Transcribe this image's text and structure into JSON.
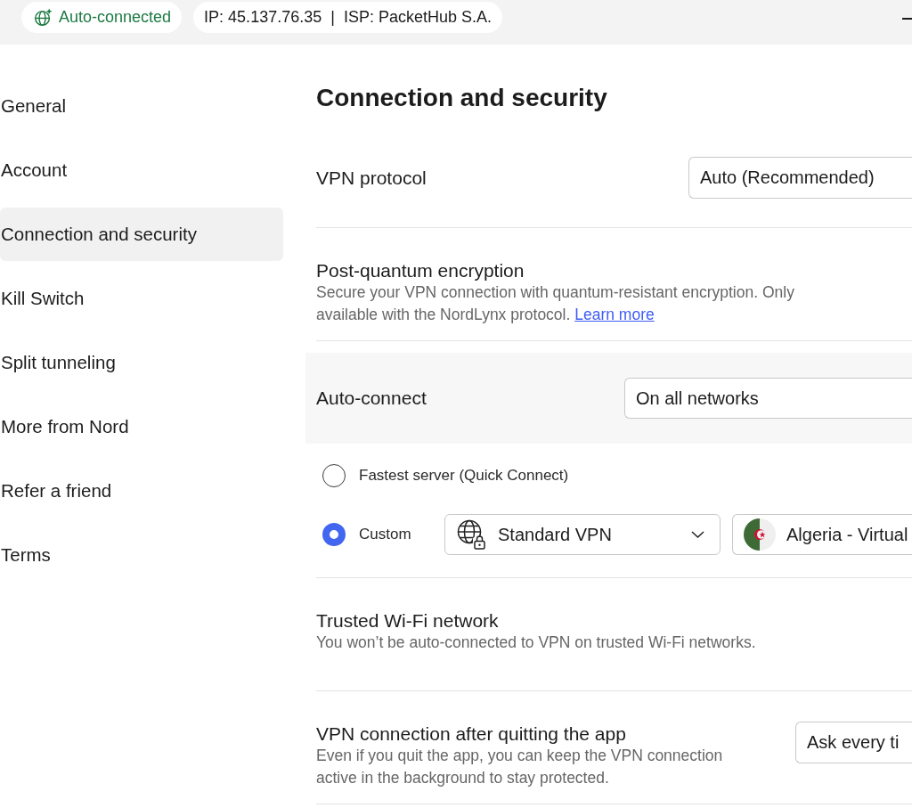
{
  "top_bar": {
    "status": "Auto-connected",
    "connection_info": "IP: 45.137.76.35  |  ISP: PacketHub S.A."
  },
  "sidebar": {
    "items": [
      {
        "label": "General",
        "selected": false
      },
      {
        "label": "Account",
        "selected": false
      },
      {
        "label": "Connection and security",
        "selected": true
      },
      {
        "label": "Kill Switch",
        "selected": false
      },
      {
        "label": "Split tunneling",
        "selected": false
      },
      {
        "label": "More from Nord",
        "selected": false
      },
      {
        "label": "Refer a friend",
        "selected": false
      },
      {
        "label": "Terms",
        "selected": false
      }
    ]
  },
  "content": {
    "title": "Connection and security",
    "settings": [
      {
        "kind": "select",
        "label": "VPN protocol",
        "value": "Auto (Recommended)"
      },
      {
        "kind": "text",
        "label": "Post-quantum encryption",
        "description": "Secure your VPN connection with quantum-resistant encryption. Only available with the NordLynx protocol.",
        "link": "Learn more"
      },
      {
        "kind": "select",
        "label": "Auto-connect",
        "value": "On all networks",
        "highlighted": true,
        "options": [
          {
            "label": "Fastest server (Quick Connect)",
            "selected": false
          },
          {
            "label": "Custom",
            "selected": true,
            "pickers": [
              {
                "kind": "category",
                "value": "Standard VPN"
              },
              {
                "kind": "country",
                "value": "Algeria - Virtual"
              }
            ]
          }
        ]
      },
      {
        "kind": "text",
        "label": "Trusted Wi-Fi network",
        "description": "You won’t be auto-connected to VPN on trusted Wi-Fi networks."
      },
      {
        "kind": "select",
        "label": "VPN connection after quitting the app",
        "description": "Even if you quit the app, you can keep the VPN connection active in the background to stay protected.",
        "value": "Ask every ti"
      }
    ]
  }
}
